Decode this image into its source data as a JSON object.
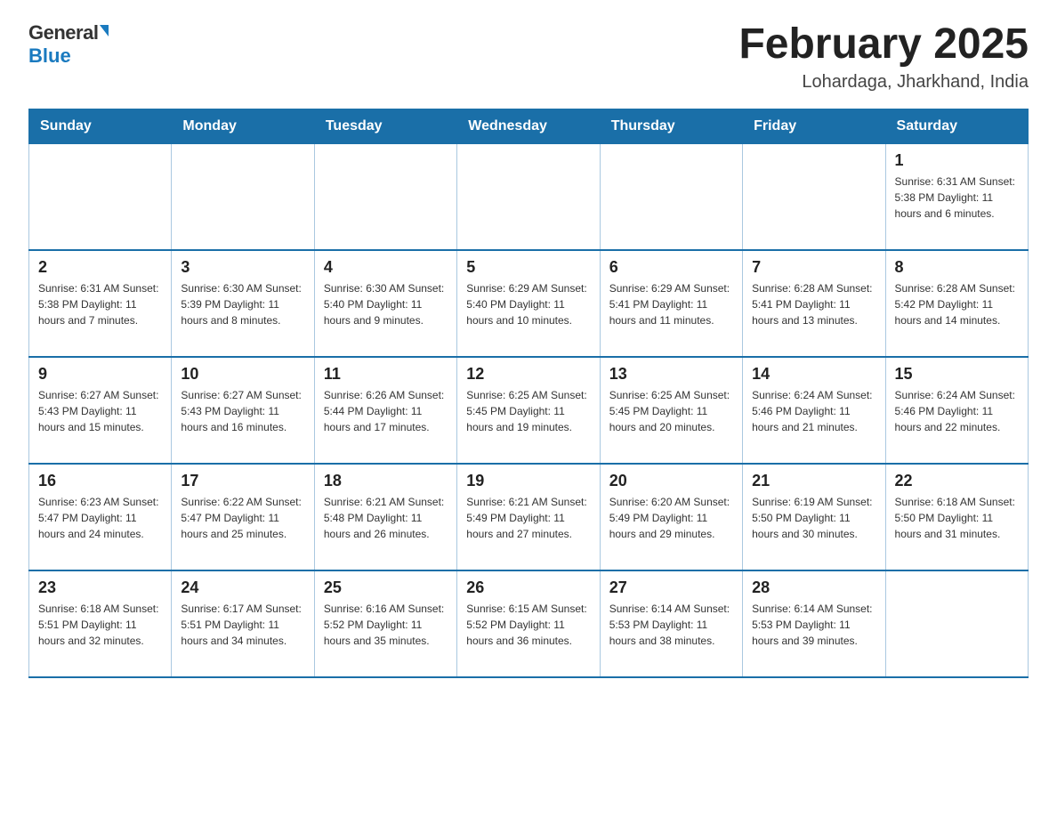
{
  "logo": {
    "general": "General",
    "blue": "Blue"
  },
  "title": "February 2025",
  "subtitle": "Lohardaga, Jharkhand, India",
  "weekdays": [
    "Sunday",
    "Monday",
    "Tuesday",
    "Wednesday",
    "Thursday",
    "Friday",
    "Saturday"
  ],
  "weeks": [
    [
      {
        "day": "",
        "info": ""
      },
      {
        "day": "",
        "info": ""
      },
      {
        "day": "",
        "info": ""
      },
      {
        "day": "",
        "info": ""
      },
      {
        "day": "",
        "info": ""
      },
      {
        "day": "",
        "info": ""
      },
      {
        "day": "1",
        "info": "Sunrise: 6:31 AM\nSunset: 5:38 PM\nDaylight: 11 hours and 6 minutes."
      }
    ],
    [
      {
        "day": "2",
        "info": "Sunrise: 6:31 AM\nSunset: 5:38 PM\nDaylight: 11 hours and 7 minutes."
      },
      {
        "day": "3",
        "info": "Sunrise: 6:30 AM\nSunset: 5:39 PM\nDaylight: 11 hours and 8 minutes."
      },
      {
        "day": "4",
        "info": "Sunrise: 6:30 AM\nSunset: 5:40 PM\nDaylight: 11 hours and 9 minutes."
      },
      {
        "day": "5",
        "info": "Sunrise: 6:29 AM\nSunset: 5:40 PM\nDaylight: 11 hours and 10 minutes."
      },
      {
        "day": "6",
        "info": "Sunrise: 6:29 AM\nSunset: 5:41 PM\nDaylight: 11 hours and 11 minutes."
      },
      {
        "day": "7",
        "info": "Sunrise: 6:28 AM\nSunset: 5:41 PM\nDaylight: 11 hours and 13 minutes."
      },
      {
        "day": "8",
        "info": "Sunrise: 6:28 AM\nSunset: 5:42 PM\nDaylight: 11 hours and 14 minutes."
      }
    ],
    [
      {
        "day": "9",
        "info": "Sunrise: 6:27 AM\nSunset: 5:43 PM\nDaylight: 11 hours and 15 minutes."
      },
      {
        "day": "10",
        "info": "Sunrise: 6:27 AM\nSunset: 5:43 PM\nDaylight: 11 hours and 16 minutes."
      },
      {
        "day": "11",
        "info": "Sunrise: 6:26 AM\nSunset: 5:44 PM\nDaylight: 11 hours and 17 minutes."
      },
      {
        "day": "12",
        "info": "Sunrise: 6:25 AM\nSunset: 5:45 PM\nDaylight: 11 hours and 19 minutes."
      },
      {
        "day": "13",
        "info": "Sunrise: 6:25 AM\nSunset: 5:45 PM\nDaylight: 11 hours and 20 minutes."
      },
      {
        "day": "14",
        "info": "Sunrise: 6:24 AM\nSunset: 5:46 PM\nDaylight: 11 hours and 21 minutes."
      },
      {
        "day": "15",
        "info": "Sunrise: 6:24 AM\nSunset: 5:46 PM\nDaylight: 11 hours and 22 minutes."
      }
    ],
    [
      {
        "day": "16",
        "info": "Sunrise: 6:23 AM\nSunset: 5:47 PM\nDaylight: 11 hours and 24 minutes."
      },
      {
        "day": "17",
        "info": "Sunrise: 6:22 AM\nSunset: 5:47 PM\nDaylight: 11 hours and 25 minutes."
      },
      {
        "day": "18",
        "info": "Sunrise: 6:21 AM\nSunset: 5:48 PM\nDaylight: 11 hours and 26 minutes."
      },
      {
        "day": "19",
        "info": "Sunrise: 6:21 AM\nSunset: 5:49 PM\nDaylight: 11 hours and 27 minutes."
      },
      {
        "day": "20",
        "info": "Sunrise: 6:20 AM\nSunset: 5:49 PM\nDaylight: 11 hours and 29 minutes."
      },
      {
        "day": "21",
        "info": "Sunrise: 6:19 AM\nSunset: 5:50 PM\nDaylight: 11 hours and 30 minutes."
      },
      {
        "day": "22",
        "info": "Sunrise: 6:18 AM\nSunset: 5:50 PM\nDaylight: 11 hours and 31 minutes."
      }
    ],
    [
      {
        "day": "23",
        "info": "Sunrise: 6:18 AM\nSunset: 5:51 PM\nDaylight: 11 hours and 32 minutes."
      },
      {
        "day": "24",
        "info": "Sunrise: 6:17 AM\nSunset: 5:51 PM\nDaylight: 11 hours and 34 minutes."
      },
      {
        "day": "25",
        "info": "Sunrise: 6:16 AM\nSunset: 5:52 PM\nDaylight: 11 hours and 35 minutes."
      },
      {
        "day": "26",
        "info": "Sunrise: 6:15 AM\nSunset: 5:52 PM\nDaylight: 11 hours and 36 minutes."
      },
      {
        "day": "27",
        "info": "Sunrise: 6:14 AM\nSunset: 5:53 PM\nDaylight: 11 hours and 38 minutes."
      },
      {
        "day": "28",
        "info": "Sunrise: 6:14 AM\nSunset: 5:53 PM\nDaylight: 11 hours and 39 minutes."
      },
      {
        "day": "",
        "info": ""
      }
    ]
  ]
}
